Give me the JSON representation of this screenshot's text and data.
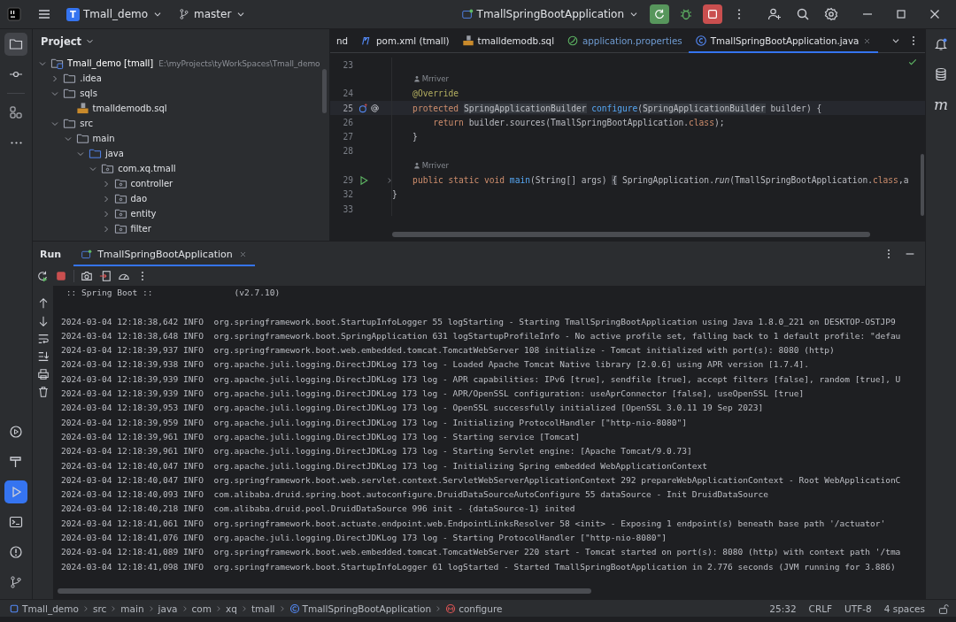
{
  "topbar": {
    "project_badge": "T",
    "project": "Tmall_demo",
    "branch": "master",
    "run_config": "TmallSpringBootApplication"
  },
  "left_toolbar": [
    {
      "kind": "project",
      "selected": true
    },
    {
      "kind": "commit",
      "selected": false
    },
    {
      "kind": "structure",
      "selected": false
    },
    {
      "kind": "more",
      "selected": false
    },
    {
      "kind": "services",
      "selected": false
    },
    {
      "kind": "build",
      "selected": false
    },
    {
      "kind": "run",
      "selected": true
    },
    {
      "kind": "terminal",
      "selected": false
    },
    {
      "kind": "problems",
      "selected": false
    },
    {
      "kind": "git",
      "selected": false
    }
  ],
  "right_toolbar": {
    "maven_label": "m"
  },
  "project_panel": {
    "title": "Project",
    "tree": [
      {
        "label": "Tmall_demo [tmall]",
        "path": "E:\\myProjects\\tyWorkSpaces\\Tmall_demo",
        "kind": "module",
        "expanded": true,
        "children": [
          {
            "label": ".idea",
            "kind": "folder",
            "expanded": false
          },
          {
            "label": "sqls",
            "kind": "folder",
            "expanded": true,
            "children": [
              {
                "label": "tmalldemodb.sql",
                "kind": "sql-file"
              }
            ]
          },
          {
            "label": "src",
            "kind": "folder",
            "expanded": true,
            "children": [
              {
                "label": "main",
                "kind": "folder",
                "expanded": true,
                "children": [
                  {
                    "label": "java",
                    "kind": "source-folder",
                    "expanded": true,
                    "children": [
                      {
                        "label": "com.xq.tmall",
                        "kind": "package",
                        "expanded": true,
                        "children": [
                          {
                            "label": "controller",
                            "kind": "package",
                            "expanded": false
                          },
                          {
                            "label": "dao",
                            "kind": "package",
                            "expanded": false
                          },
                          {
                            "label": "entity",
                            "kind": "package",
                            "expanded": false
                          },
                          {
                            "label": "filter",
                            "kind": "package",
                            "expanded": false
                          }
                        ]
                      }
                    ]
                  }
                ]
              }
            ]
          }
        ]
      }
    ]
  },
  "editor": {
    "tabs": [
      {
        "label": "nd",
        "kind": "plain",
        "selected": false,
        "color": "#dfe1e5"
      },
      {
        "label": "pom.xml (tmall)",
        "kind": "maven",
        "selected": false,
        "color": "#dfe1e5"
      },
      {
        "label": "tmalldemodb.sql",
        "kind": "sql",
        "selected": false,
        "color": "#dfe1e5"
      },
      {
        "label": "application.properties",
        "kind": "properties",
        "selected": false,
        "color": "#6f9bd1"
      },
      {
        "label": "TmallSpringBootApplication.java",
        "kind": "java",
        "selected": true,
        "color": "#dfe1e5"
      }
    ],
    "lines": [
      {
        "kind": "code",
        "number": "23",
        "current": false
      },
      {
        "kind": "hint",
        "text": "Mrriver"
      },
      {
        "kind": "code",
        "number": "24",
        "current": false,
        "tokens": [
          {
            "text": "    @Override",
            "kind": "annotation"
          }
        ]
      },
      {
        "kind": "override",
        "number": "25",
        "current": true,
        "tokens": [
          {
            "text": "    protected ",
            "kind": "keyword"
          },
          {
            "text": "SpringApplicationBuilder",
            "kind": "usage"
          },
          {
            "text": " configure",
            "kind": "method"
          },
          {
            "text": "(",
            "kind": "plain"
          },
          {
            "text": "SpringApplicationBuilder",
            "kind": "usage"
          },
          {
            "text": " builder) {",
            "kind": "plain"
          }
        ]
      },
      {
        "kind": "code",
        "number": "26",
        "current": false,
        "tokens": [
          {
            "text": "        return",
            "kind": "keyword"
          },
          {
            "text": " builder.sources(TmallSpringBootApplication.",
            "kind": "plain"
          },
          {
            "text": "class",
            "kind": "keyword"
          },
          {
            "text": ");",
            "kind": "plain"
          }
        ]
      },
      {
        "kind": "code",
        "number": "27",
        "current": false,
        "tokens": [
          {
            "text": "    }",
            "kind": "plain"
          }
        ]
      },
      {
        "kind": "code",
        "number": "28",
        "current": false
      },
      {
        "kind": "hint",
        "text": "Mrriver"
      },
      {
        "kind": "run",
        "number": "29",
        "current": false,
        "tokens": [
          {
            "text": "    public static void ",
            "kind": "keyword"
          },
          {
            "text": "main",
            "kind": "method"
          },
          {
            "text": "(String[] args) ",
            "kind": "plain"
          },
          {
            "text": "{",
            "kind": "folded"
          },
          {
            "text": " SpringApplication.",
            "kind": "plain"
          },
          {
            "text": "run",
            "kind": "italic"
          },
          {
            "text": "(TmallSpringBootApplication.",
            "kind": "plain"
          },
          {
            "text": "class",
            "kind": "keyword"
          },
          {
            "text": ",a",
            "kind": "plain"
          }
        ]
      },
      {
        "kind": "code",
        "number": "32",
        "current": false,
        "tokens": [
          {
            "text": "}",
            "kind": "plain"
          }
        ]
      },
      {
        "kind": "code",
        "number": "33",
        "current": false
      }
    ]
  },
  "run_panel": {
    "title": "Run",
    "tabs": [
      {
        "label": "TmallSpringBootApplication",
        "selected": true
      }
    ],
    "console": [
      " :: Spring Boot ::                (v2.7.10)",
      "2024-03-04 12:18:38,642 INFO  org.springframework.boot.StartupInfoLogger 55 logStarting - Starting TmallSpringBootApplication using Java 1.8.0_221 on DESKTOP-OSTJP9",
      "2024-03-04 12:18:38,648 INFO  org.springframework.boot.SpringApplication 631 logStartupProfileInfo - No active profile set, falling back to 1 default profile: \"defau",
      "2024-03-04 12:18:39,937 INFO  org.springframework.boot.web.embedded.tomcat.TomcatWebServer 108 initialize - Tomcat initialized with port(s): 8080 (http)",
      "2024-03-04 12:18:39,938 INFO  org.apache.juli.logging.DirectJDKLog 173 log - Loaded Apache Tomcat Native library [2.0.6] using APR version [1.7.4].",
      "2024-03-04 12:18:39,939 INFO  org.apache.juli.logging.DirectJDKLog 173 log - APR capabilities: IPv6 [true], sendfile [true], accept filters [false], random [true], U",
      "2024-03-04 12:18:39,939 INFO  org.apache.juli.logging.DirectJDKLog 173 log - APR/OpenSSL configuration: useAprConnector [false], useOpenSSL [true]",
      "2024-03-04 12:18:39,953 INFO  org.apache.juli.logging.DirectJDKLog 173 log - OpenSSL successfully initialized [OpenSSL 3.0.11 19 Sep 2023]",
      "2024-03-04 12:18:39,959 INFO  org.apache.juli.logging.DirectJDKLog 173 log - Initializing ProtocolHandler [\"http-nio-8080\"]",
      "2024-03-04 12:18:39,961 INFO  org.apache.juli.logging.DirectJDKLog 173 log - Starting service [Tomcat]",
      "2024-03-04 12:18:39,961 INFO  org.apache.juli.logging.DirectJDKLog 173 log - Starting Servlet engine: [Apache Tomcat/9.0.73]",
      "2024-03-04 12:18:40,047 INFO  org.apache.juli.logging.DirectJDKLog 173 log - Initializing Spring embedded WebApplicationContext",
      "2024-03-04 12:18:40,047 INFO  org.springframework.boot.web.servlet.context.ServletWebServerApplicationContext 292 prepareWebApplicationContext - Root WebApplicationC",
      "2024-03-04 12:18:40,093 INFO  com.alibaba.druid.spring.boot.autoconfigure.DruidDataSourceAutoConfigure 55 dataSource - Init DruidDataSource",
      "2024-03-04 12:18:40,218 INFO  com.alibaba.druid.pool.DruidDataSource 996 init - {dataSource-1} inited",
      "2024-03-04 12:18:41,061 INFO  org.springframework.boot.actuate.endpoint.web.EndpointLinksResolver 58 <init> - Exposing 1 endpoint(s) beneath base path '/actuator'",
      "2024-03-04 12:18:41,076 INFO  org.apache.juli.logging.DirectJDKLog 173 log - Starting ProtocolHandler [\"http-nio-8080\"]",
      "2024-03-04 12:18:41,089 INFO  org.springframework.boot.web.embedded.tomcat.TomcatWebServer 220 start - Tomcat started on port(s): 8080 (http) with context path '/tma",
      "2024-03-04 12:18:41,098 INFO  org.springframework.boot.StartupInfoLogger 61 logStarted - Started TmallSpringBootApplication in 2.776 seconds (JVM running for 3.886)"
    ]
  },
  "status_bar": {
    "breadcrumb": [
      {
        "label": "Tmall_demo",
        "kind": "module"
      },
      {
        "label": "src",
        "kind": "plain"
      },
      {
        "label": "main",
        "kind": "plain"
      },
      {
        "label": "java",
        "kind": "plain"
      },
      {
        "label": "com",
        "kind": "plain"
      },
      {
        "label": "xq",
        "kind": "plain"
      },
      {
        "label": "tmall",
        "kind": "plain"
      },
      {
        "label": "TmallSpringBootApplication",
        "kind": "class"
      },
      {
        "label": "configure",
        "kind": "method"
      }
    ],
    "items": [
      "25:32",
      "CRLF",
      "UTF-8",
      "4 spaces"
    ]
  }
}
